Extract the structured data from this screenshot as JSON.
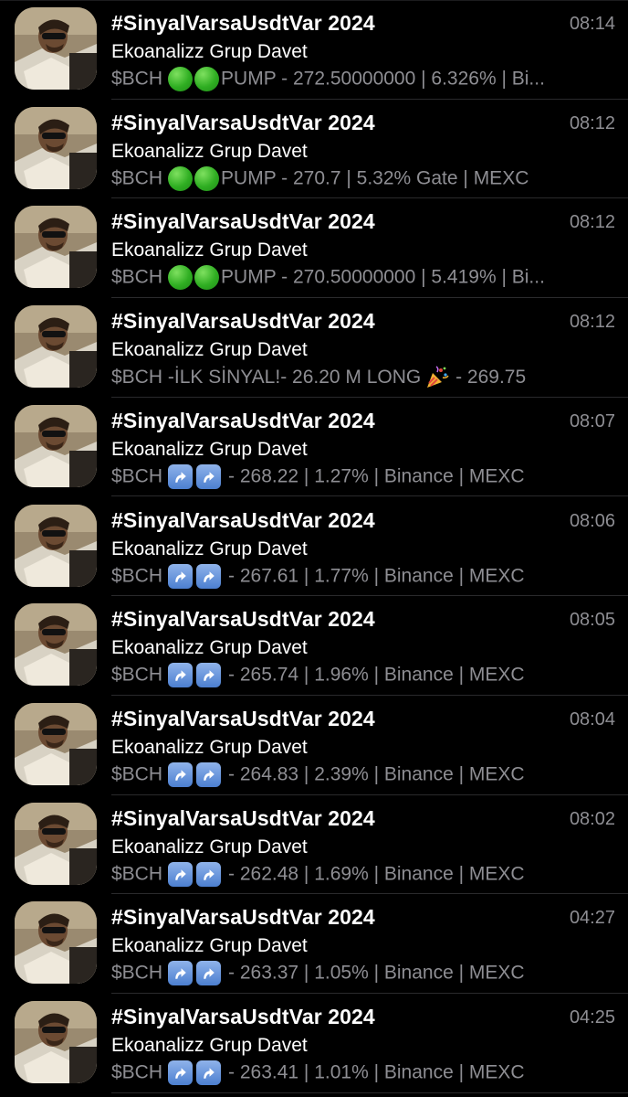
{
  "chats": [
    {
      "title": "#SinyalVarsaUsdtVar 2024",
      "sender": "Ekoanalizz Grup Davet",
      "time": "08:14",
      "prefix": "$BCH",
      "emoji": "green-dots",
      "text": "PUMP - 272.50000000 | 6.326% | Bi..."
    },
    {
      "title": "#SinyalVarsaUsdtVar 2024",
      "sender": "Ekoanalizz Grup Davet",
      "time": "08:12",
      "prefix": "$BCH",
      "emoji": "green-dots",
      "text": "PUMP - 270.7 | 5.32% Gate | MEXC"
    },
    {
      "title": "#SinyalVarsaUsdtVar 2024",
      "sender": "Ekoanalizz Grup Davet",
      "time": "08:12",
      "prefix": "$BCH",
      "emoji": "green-dots",
      "text": "PUMP - 270.50000000 | 5.419% | Bi..."
    },
    {
      "title": "#SinyalVarsaUsdtVar 2024",
      "sender": "Ekoanalizz Grup Davet",
      "time": "08:12",
      "prefix": "$BCH",
      "emoji": "party",
      "text": "-İLK SİNYAL!- 26.20 M LONG",
      "suffix": "- 269.75"
    },
    {
      "title": "#SinyalVarsaUsdtVar 2024",
      "sender": "Ekoanalizz Grup Davet",
      "time": "08:07",
      "prefix": "$BCH",
      "emoji": "up-arrows",
      "text": "- 268.22 | 1.27% | Binance | MEXC"
    },
    {
      "title": "#SinyalVarsaUsdtVar 2024",
      "sender": "Ekoanalizz Grup Davet",
      "time": "08:06",
      "prefix": "$BCH",
      "emoji": "up-arrows",
      "text": "- 267.61 | 1.77% | Binance | MEXC"
    },
    {
      "title": "#SinyalVarsaUsdtVar 2024",
      "sender": "Ekoanalizz Grup Davet",
      "time": "08:05",
      "prefix": "$BCH",
      "emoji": "up-arrows",
      "text": "- 265.74 | 1.96% | Binance | MEXC"
    },
    {
      "title": "#SinyalVarsaUsdtVar 2024",
      "sender": "Ekoanalizz Grup Davet",
      "time": "08:04",
      "prefix": "$BCH",
      "emoji": "up-arrows",
      "text": "- 264.83 | 2.39% | Binance | MEXC"
    },
    {
      "title": "#SinyalVarsaUsdtVar 2024",
      "sender": "Ekoanalizz Grup Davet",
      "time": "08:02",
      "prefix": "$BCH",
      "emoji": "up-arrows",
      "text": "- 262.48 | 1.69% | Binance | MEXC"
    },
    {
      "title": "#SinyalVarsaUsdtVar 2024",
      "sender": "Ekoanalizz Grup Davet",
      "time": "04:27",
      "prefix": "$BCH",
      "emoji": "up-arrows",
      "text": "- 263.37 | 1.05% | Binance | MEXC"
    },
    {
      "title": "#SinyalVarsaUsdtVar 2024",
      "sender": "Ekoanalizz Grup Davet",
      "time": "04:25",
      "prefix": "$BCH",
      "emoji": "up-arrows",
      "text": "- 263.41 | 1.01% | Binance | MEXC"
    }
  ],
  "colors": {
    "background": "#000000",
    "title": "#ffffff",
    "secondary": "#8e8e93",
    "separator": "#2a2a2c",
    "green_dot": "#2fae22",
    "arrow_box": "#4c7fd0"
  }
}
